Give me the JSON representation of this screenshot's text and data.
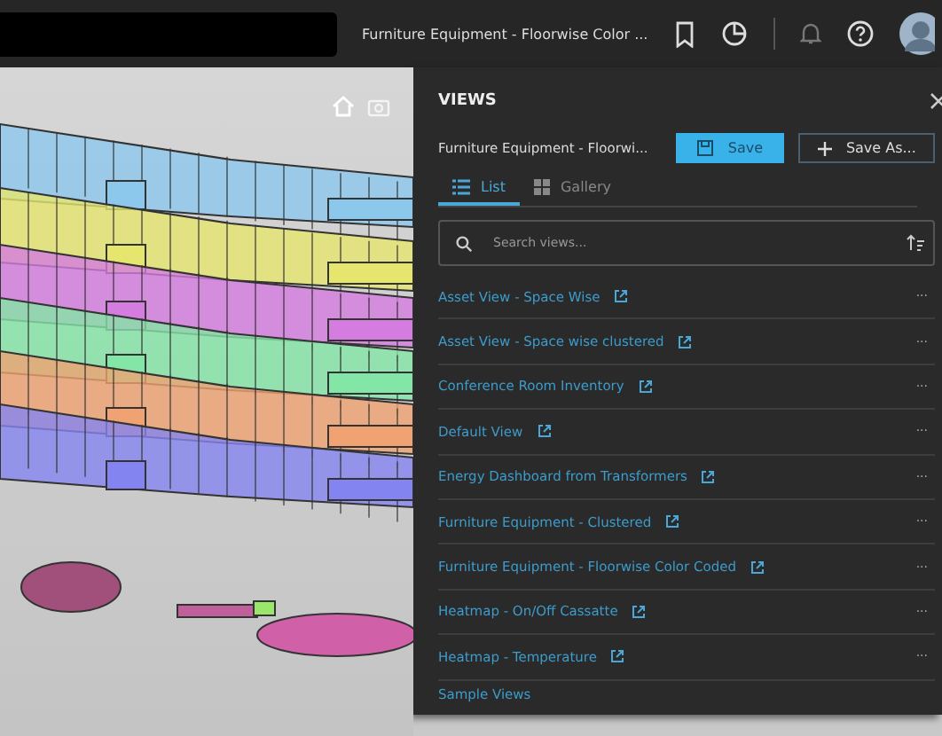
{
  "top_bar": {
    "title": "Furniture Equipment - Floorwise Color ..."
  },
  "views_panel": {
    "title": "VIEWS",
    "current_view": "Furniture Equipment - Floorwi...",
    "save_button": "Save",
    "save_as_button": "Save As...",
    "tabs": [
      {
        "label": "List",
        "kind": "list",
        "selected": true
      },
      {
        "label": "Gallery",
        "kind": "gallery",
        "selected": false
      }
    ],
    "search": {
      "placeholder": "Search views..."
    },
    "views": [
      {
        "name": "Asset View - Space Wise"
      },
      {
        "name": "Asset View - Space wise clustered"
      },
      {
        "name": "Conference Room Inventory"
      },
      {
        "name": "Default View"
      },
      {
        "name": "Energy Dashboard from Transformers"
      },
      {
        "name": "Furniture Equipment - Clustered"
      },
      {
        "name": "Furniture Equipment - Floorwise Color Coded"
      },
      {
        "name": "Heatmap - On/Off Cassatte"
      },
      {
        "name": "Heatmap - Temperature"
      }
    ],
    "more_label": "···",
    "footer_link": "Sample Views"
  }
}
